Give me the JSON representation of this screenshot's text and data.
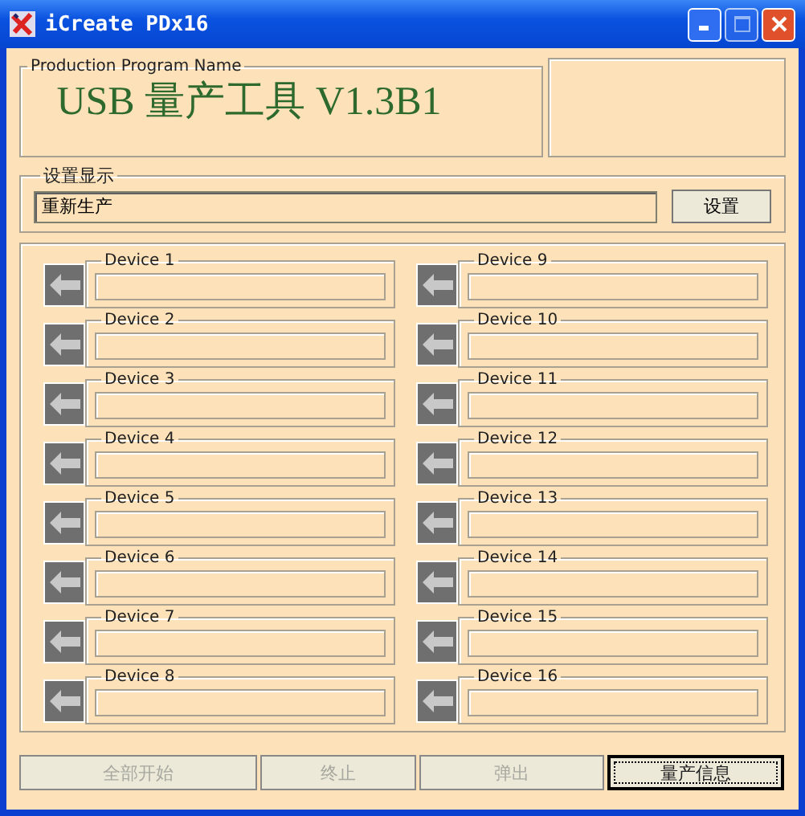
{
  "window": {
    "title": "iCreate PDx16"
  },
  "program": {
    "legend": "Production Program Name",
    "name": "USB 量产工具 V1.3B1"
  },
  "settings": {
    "legend": "设置显示",
    "value": "重新生产",
    "button": "设置"
  },
  "devices": [
    {
      "label": "Device 1"
    },
    {
      "label": "Device 2"
    },
    {
      "label": "Device 3"
    },
    {
      "label": "Device 4"
    },
    {
      "label": "Device 5"
    },
    {
      "label": "Device 6"
    },
    {
      "label": "Device 7"
    },
    {
      "label": "Device 8"
    },
    {
      "label": "Device 9"
    },
    {
      "label": "Device 10"
    },
    {
      "label": "Device 11"
    },
    {
      "label": "Device 12"
    },
    {
      "label": "Device 13"
    },
    {
      "label": "Device 14"
    },
    {
      "label": "Device 15"
    },
    {
      "label": "Device 16"
    }
  ],
  "buttons": [
    {
      "label": "全部开始",
      "disabled": true,
      "focused": false
    },
    {
      "label": "终止",
      "disabled": true,
      "focused": false
    },
    {
      "label": "弹出",
      "disabled": true,
      "focused": false
    },
    {
      "label": "量产信息",
      "disabled": false,
      "focused": true
    }
  ]
}
